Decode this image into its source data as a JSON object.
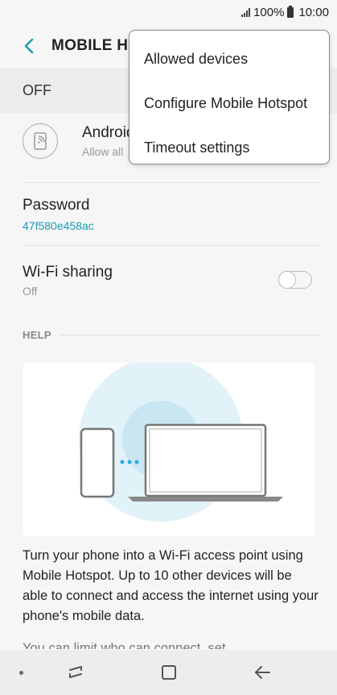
{
  "status_bar": {
    "battery": "100%",
    "time": "10:00"
  },
  "app_bar": {
    "title": "MOBILE HOTSPOT"
  },
  "master_switch": {
    "label": "OFF"
  },
  "device": {
    "name": "Android",
    "subtitle": "Allow all"
  },
  "password": {
    "label": "Password",
    "value": "47f580e458ac"
  },
  "wifi_sharing": {
    "label": "Wi-Fi sharing",
    "value": "Off",
    "enabled": false
  },
  "help": {
    "header": "HELP",
    "text": "Turn your phone into a Wi-Fi access point using Mobile Hotspot. Up to 10 other devices will be able to connect and access the internet using your phone's mobile data.",
    "text_cut": "You can limit who can connect, set"
  },
  "overflow_menu": {
    "items": [
      "Allowed devices",
      "Configure Mobile Hotspot",
      "Timeout settings"
    ]
  },
  "colors": {
    "accent": "#1a9bb5",
    "menu_bg": "#ffffff"
  },
  "icons": {
    "back": "back-arrow-icon",
    "device": "phone-hotspot-icon",
    "nav_recent": "recent-apps-icon",
    "nav_home": "home-icon",
    "nav_back": "back-icon"
  }
}
